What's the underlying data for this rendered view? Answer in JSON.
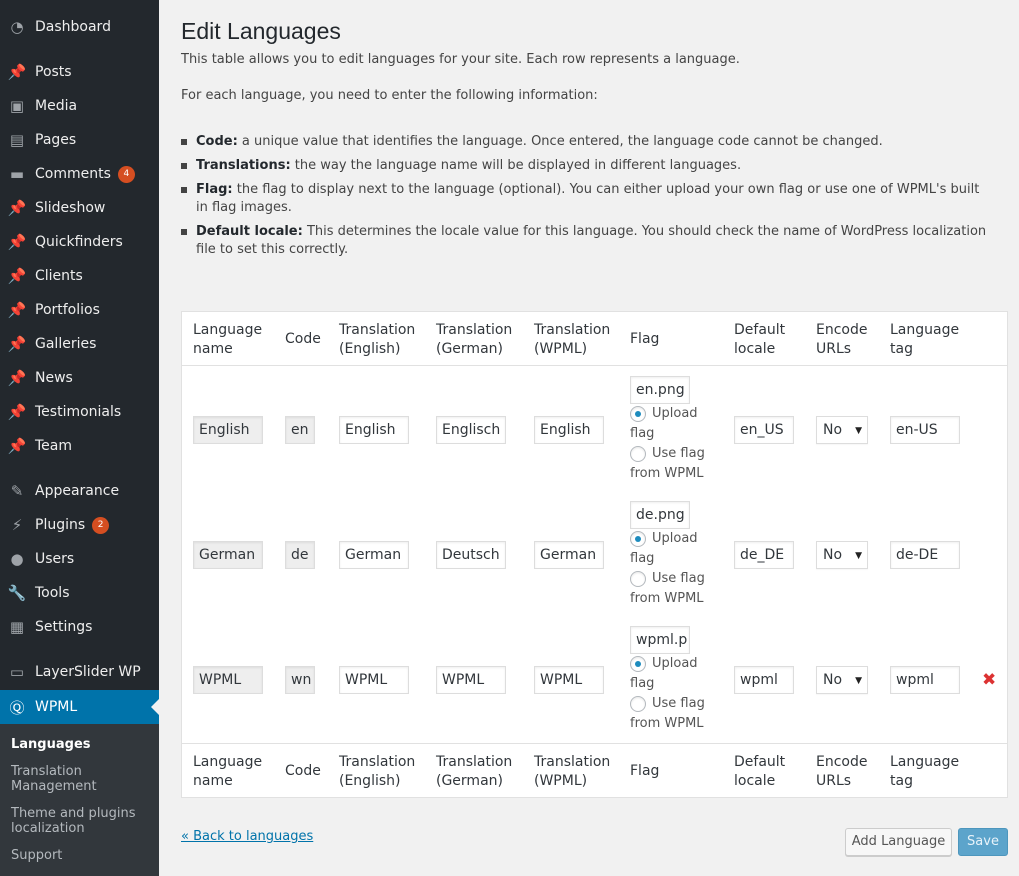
{
  "sidebar": {
    "items": [
      {
        "label": "Dashboard",
        "icon": "dashboard-icon",
        "glyph": "◔"
      },
      {
        "label": "Posts",
        "icon": "pin-icon",
        "glyph": "📌"
      },
      {
        "label": "Media",
        "icon": "media-icon",
        "glyph": "▣"
      },
      {
        "label": "Pages",
        "icon": "pages-icon",
        "glyph": "▤"
      },
      {
        "label": "Comments",
        "icon": "comments-icon",
        "glyph": "▬",
        "badge": "4"
      },
      {
        "label": "Slideshow",
        "icon": "pin-icon",
        "glyph": "📌"
      },
      {
        "label": "Quickfinders",
        "icon": "pin-icon",
        "glyph": "📌"
      },
      {
        "label": "Clients",
        "icon": "pin-icon",
        "glyph": "📌"
      },
      {
        "label": "Portfolios",
        "icon": "pin-icon",
        "glyph": "📌"
      },
      {
        "label": "Galleries",
        "icon": "pin-icon",
        "glyph": "📌"
      },
      {
        "label": "News",
        "icon": "pin-icon",
        "glyph": "📌"
      },
      {
        "label": "Testimonials",
        "icon": "pin-icon",
        "glyph": "📌"
      },
      {
        "label": "Team",
        "icon": "pin-icon",
        "glyph": "📌"
      },
      {
        "label": "Appearance",
        "icon": "brush-icon",
        "glyph": "✎"
      },
      {
        "label": "Plugins",
        "icon": "plug-icon",
        "glyph": "⚡",
        "badge": "2"
      },
      {
        "label": "Users",
        "icon": "user-icon",
        "glyph": "●"
      },
      {
        "label": "Tools",
        "icon": "wrench-icon",
        "glyph": "🔧"
      },
      {
        "label": "Settings",
        "icon": "settings-icon",
        "glyph": "▦"
      },
      {
        "label": "LayerSlider WP",
        "icon": "layers-icon",
        "glyph": "▭"
      },
      {
        "label": "WPML",
        "icon": "wpml-icon",
        "glyph": "Ⓠ",
        "current": true
      }
    ],
    "submenu": [
      {
        "label": "Languages",
        "current": true
      },
      {
        "label": "Translation Management"
      },
      {
        "label": "Theme and plugins localization"
      },
      {
        "label": "Support"
      }
    ]
  },
  "page": {
    "title": "Edit Languages",
    "intro": "This table allows you to edit languages for your site. Each row represents a language.",
    "intro2": "For each language, you need to enter the following information:",
    "bullets": [
      {
        "term": "Code:",
        "text": " a unique value that identifies the language. Once entered, the language code cannot be changed."
      },
      {
        "term": "Translations:",
        "text": " the way the language name will be displayed in different languages."
      },
      {
        "term": "Flag:",
        "text": " the flag to display next to the language (optional). You can either upload your own flag or use one of WPML's built in flag images."
      },
      {
        "term": "Default locale:",
        "text": " This determines the locale value for this language. You should check the name of WordPress localization file to set this correctly."
      }
    ]
  },
  "table": {
    "headers": [
      {
        "line1": "Language",
        "line2": "name"
      },
      {
        "line1": "Code",
        "line2": ""
      },
      {
        "line1": "Translation",
        "line2": "(English)"
      },
      {
        "line1": "Translation",
        "line2": "(German)"
      },
      {
        "line1": "Translation",
        "line2": "(WPML)"
      },
      {
        "line1": "Flag",
        "line2": ""
      },
      {
        "line1": "Default",
        "line2": "locale"
      },
      {
        "line1": "Encode",
        "line2": "URLs"
      },
      {
        "line1": "Language",
        "line2": "tag"
      }
    ],
    "flag_options": {
      "upload_line1": "Upload",
      "upload_line2": "flag",
      "wpml_line1": "Use flag",
      "wpml_line2": "from WPML"
    },
    "rows": [
      {
        "name": "English",
        "code": "en",
        "tr_en": "English",
        "tr_de": "Englisch",
        "tr_wpml": "English",
        "flag": "en.png",
        "flag_choice": "upload",
        "locale": "en_US",
        "encode": "No",
        "tag": "en-US",
        "deletable": false
      },
      {
        "name": "German",
        "code": "de",
        "tr_en": "German",
        "tr_de": "Deutsch",
        "tr_wpml": "German",
        "flag": "de.png",
        "flag_choice": "upload",
        "locale": "de_DE",
        "encode": "No",
        "tag": "de-DE",
        "deletable": false
      },
      {
        "name": "WPML",
        "code": "wn",
        "tr_en": "WPML",
        "tr_de": "WPML",
        "tr_wpml": "WPML",
        "flag": "wpml.p",
        "flag_choice": "upload",
        "locale": "wpml",
        "encode": "No",
        "tag": "wpml",
        "deletable": true
      }
    ]
  },
  "footer": {
    "back_link": "« Back to languages",
    "add_button": "Add Language",
    "save_button": "Save"
  },
  "colors": {
    "sidebar_bg": "#23282d",
    "submenu_bg": "#32373c",
    "accent": "#0073aa",
    "badge": "#d54e21",
    "delete": "#dc3232"
  }
}
